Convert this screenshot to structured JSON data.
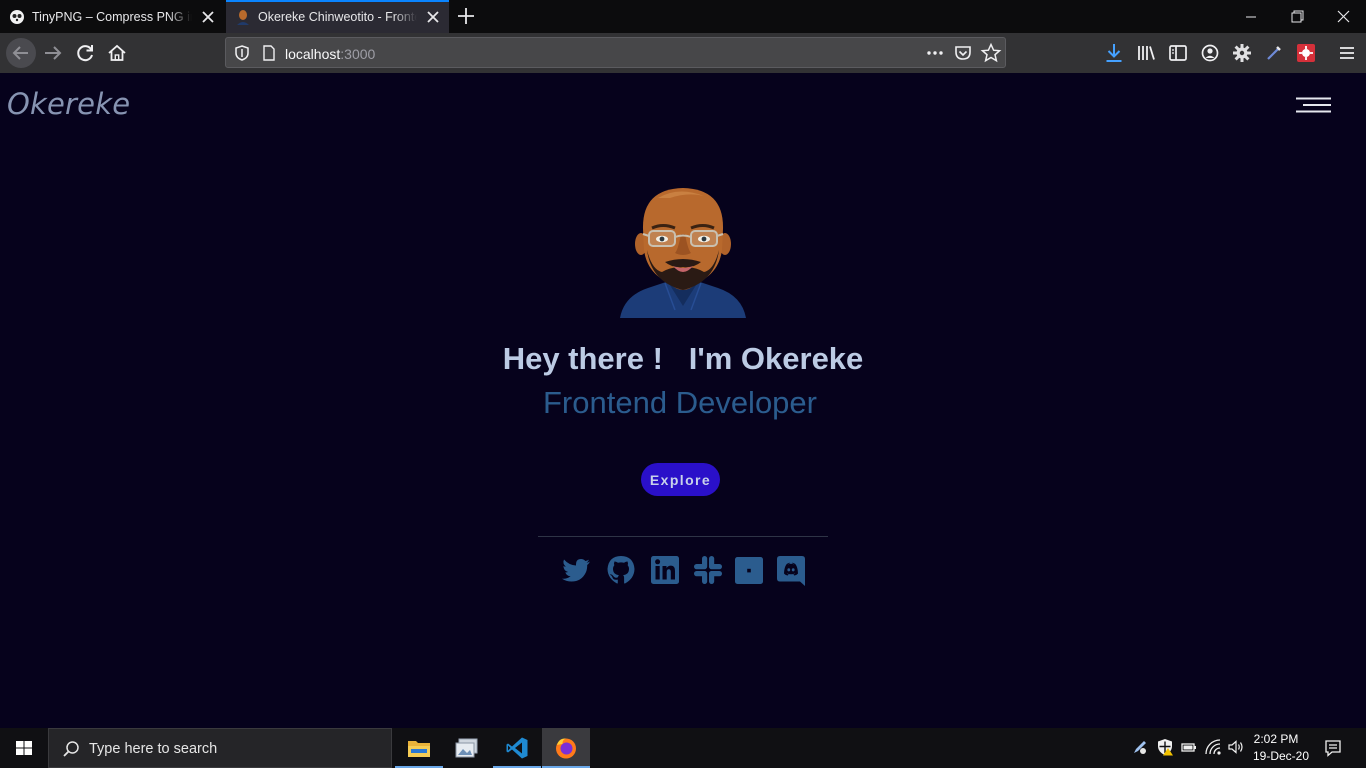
{
  "browser": {
    "tabs": [
      {
        "title": "TinyPNG – Compress PNG images",
        "favicon": "tinypng-panda-icon",
        "active": false
      },
      {
        "title": "Okereke Chinweotito - Frontend Developer",
        "favicon": "avatar-favicon-icon",
        "active": true
      }
    ],
    "url": {
      "host": "localhost",
      "port": ":3000"
    },
    "accent_color": "#0a84ff"
  },
  "page": {
    "brand": "Okereke",
    "headline": "Hey there !   I'm Okereke",
    "subtitle": "Frontend Developer",
    "cta_label": "Explore",
    "colors": {
      "background": "#06021c",
      "headline": "#bccbe4",
      "subtitle": "#2b5c8e",
      "button": "#2a10c9",
      "social_icons": "#2b5c8e"
    },
    "social": [
      "twitter-icon",
      "github-icon",
      "linkedin-icon",
      "slack-icon",
      "generic-app-icon",
      "discord-icon"
    ]
  },
  "taskbar": {
    "search_placeholder": "Type here to search",
    "apps": [
      "file-explorer-icon",
      "image-viewer-icon",
      "vscode-icon",
      "firefox-icon"
    ],
    "clock": {
      "time": "2:02 PM",
      "date": "19-Dec-20"
    }
  }
}
